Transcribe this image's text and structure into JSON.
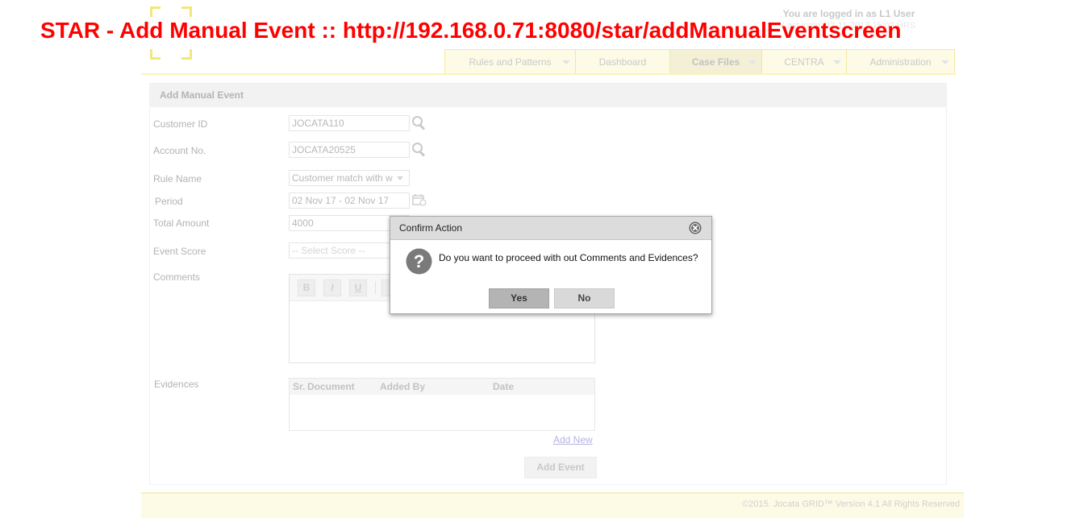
{
  "page_title": "STAR - Add Manual Event :: http://192.168.0.71:8080/star/addManualEventscreen",
  "header": {
    "logged_in_text": "You are logged in as L1 User",
    "logged_in_sub": "Last login: 02-11-2017 15:02 HRS"
  },
  "nav": {
    "tabs": [
      {
        "label": "Rules and Patterns"
      },
      {
        "label": "Dashboard"
      },
      {
        "label": "Case Files"
      },
      {
        "label": "CENTRA"
      },
      {
        "label": "Administration"
      }
    ]
  },
  "panel": {
    "title": "Add Manual Event",
    "labels": {
      "customer_id": "Customer ID",
      "account_no": "Account No.",
      "rule_name": "Rule Name",
      "period": "Period",
      "total_amount": "Total Amount",
      "event_score": "Event Score",
      "comments": "Comments",
      "evidences": "Evidences"
    },
    "values": {
      "customer_id": "JOCATA110",
      "account_no": "JOCATA20525",
      "rule_name": "Customer match with w",
      "period": "02 Nov 17 - 02 Nov 17",
      "total_amount": "4000",
      "event_score_placeholder": "-- Select Score --"
    },
    "editor_buttons": [
      "B",
      "I",
      "U"
    ],
    "evidence_columns": [
      "Sr.",
      "Document",
      "Added By",
      "Date"
    ],
    "add_new_link": "Add New",
    "add_event_button": "Add Event"
  },
  "footer": {
    "copyright": "©2015. Jocata GRID™ Version 4.1 All Rights Reserved"
  },
  "dialog": {
    "title": "Confirm Action",
    "message": "Do you want to proceed with out Comments and Evidences?",
    "yes_label": "Yes",
    "no_label": "No"
  },
  "colors": {
    "overlay_title": "#ff0000",
    "nav_bg": "#fdfbe6",
    "dialog_header": "#dcdcdc"
  }
}
